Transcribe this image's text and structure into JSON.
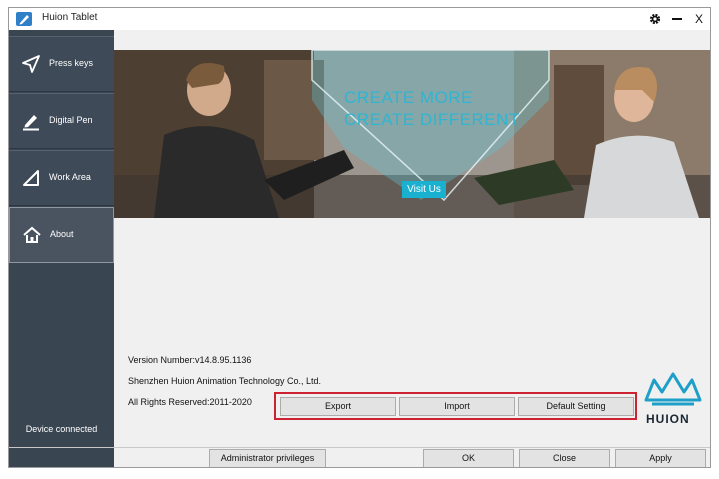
{
  "window": {
    "title": "Huion Tablet"
  },
  "titlebar": {
    "settings_icon": "gear-icon",
    "minimize_icon": "minimize-icon",
    "close_label": "X"
  },
  "sidebar": {
    "items": [
      {
        "label": "Press keys",
        "icon": "send-arrow-icon"
      },
      {
        "label": "Digital Pen",
        "icon": "pen-icon"
      },
      {
        "label": "Work Area",
        "icon": "triangle-ruler-icon"
      },
      {
        "label": "About",
        "icon": "home-icon",
        "active": true
      }
    ],
    "status": "Device connected"
  },
  "banner": {
    "headline_1": "CREATE MORE",
    "headline_2": "CREATE DIFFERENT",
    "visit_label": "Visit Us"
  },
  "about": {
    "version": "Version Number:v14.8.95.1136",
    "company": "Shenzhen Huion Animation Technology Co., Ltd.",
    "rights": "All Rights Reserved:2011-2020",
    "buttons": {
      "export": "Export",
      "import": "Import",
      "default": "Default Setting"
    },
    "logo_text": "HUION"
  },
  "footer": {
    "admin": "Administrator privileges",
    "ok": "OK",
    "close": "Close",
    "apply": "Apply"
  },
  "colors": {
    "accent": "#1e9fc8",
    "sidebar": "#3a4552",
    "highlight_box": "#cc2231"
  }
}
